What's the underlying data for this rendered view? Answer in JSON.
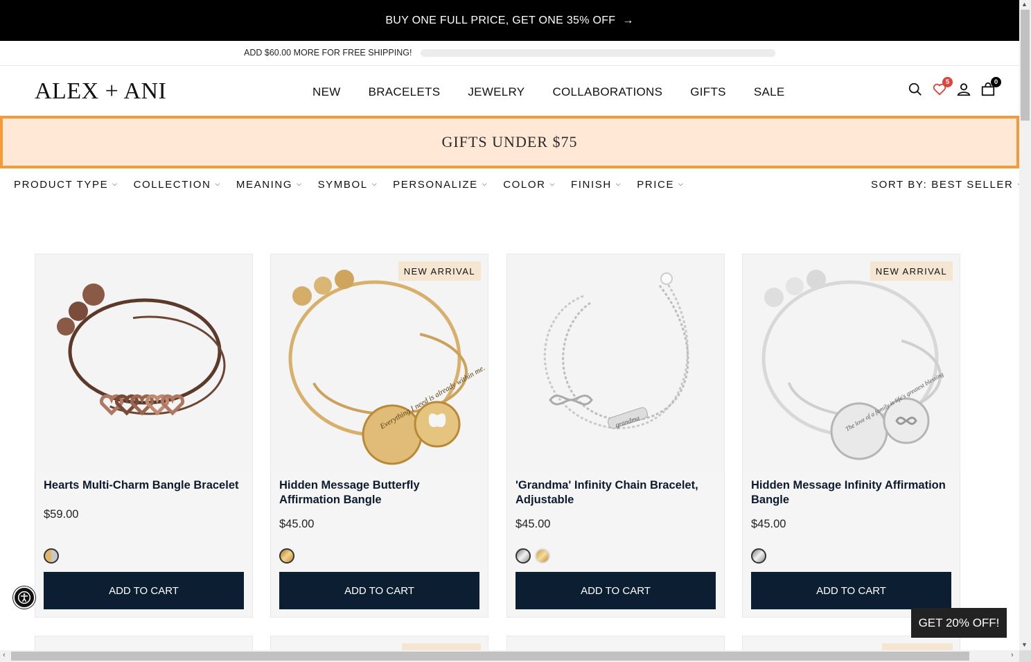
{
  "promo": {
    "text": "BUY ONE FULL PRICE, GET ONE 35% OFF",
    "arrow": "→"
  },
  "shipping": {
    "text": "ADD $60.00 MORE FOR FREE SHIPPING!",
    "progress_percent": 0
  },
  "header": {
    "logo": "ALEX + ANI",
    "nav": [
      "NEW",
      "BRACELETS",
      "JEWELRY",
      "COLLABORATIONS",
      "GIFTS",
      "SALE"
    ],
    "icons": {
      "search": "search-icon",
      "wishlist": "heart-icon",
      "account": "user-icon",
      "cart": "bag-icon"
    },
    "wishlist_count": "5",
    "cart_count": "0"
  },
  "banner": {
    "text": "GIFTS UNDER $75"
  },
  "filters": {
    "items": [
      "PRODUCT TYPE",
      "COLLECTION",
      "MEANING",
      "SYMBOL",
      "PERSONALIZE",
      "COLOR",
      "FINISH",
      "PRICE"
    ],
    "sort_label": "SORT BY:",
    "sort_value": "BEST SELLER"
  },
  "products": [
    {
      "name": "Hearts Multi-Charm Bangle Bracelet",
      "price": "$59.00",
      "tag": "",
      "swatches": [
        "mixed"
      ],
      "cta": "ADD TO CART"
    },
    {
      "name": "Hidden Message Butterfly Affirmation Bangle",
      "price": "$45.00",
      "tag": "NEW ARRIVAL",
      "swatches": [
        "gold"
      ],
      "cta": "ADD TO CART"
    },
    {
      "name": "'Grandma' Infinity Chain Bracelet, Adjustable",
      "price": "$45.00",
      "tag": "",
      "swatches": [
        "silver",
        "gold"
      ],
      "cta": "ADD TO CART"
    },
    {
      "name": "Hidden Message Infinity Affirmation Bangle",
      "price": "$45.00",
      "tag": "NEW ARRIVAL",
      "swatches": [
        "silver"
      ],
      "cta": "ADD TO CART"
    }
  ],
  "engraving_texts": {
    "butterfly": "Everything I need is already within me.",
    "grandma": "grandma",
    "infinity": "The love of a family is life's greatest blessing"
  },
  "discount_button": "GET 20% OFF!",
  "colors": {
    "promo_bg": "#000000",
    "banner_bg": "#ffe9d6",
    "banner_border": "#f39a3b",
    "button_bg": "#0c1e31",
    "tag_bg": "#f5e6d2",
    "badge_red": "#d9473f"
  }
}
